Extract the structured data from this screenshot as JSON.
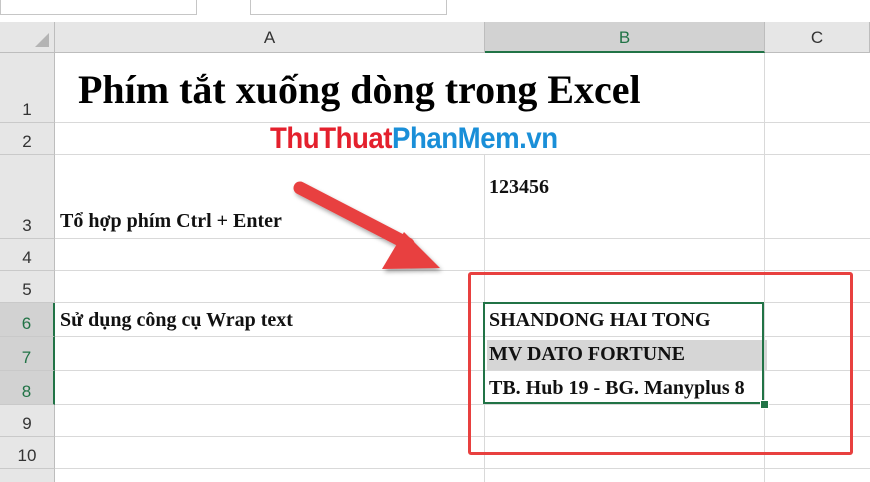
{
  "columns": [
    "A",
    "B",
    "C"
  ],
  "rows": [
    "1",
    "2",
    "3",
    "4",
    "5",
    "6",
    "7",
    "8",
    "9",
    "10"
  ],
  "cells": {
    "A1": "Phím tắt xuống dòng trong Excel",
    "A2_part1": "ThuThuat",
    "A2_part2": "PhanMem.vn",
    "B3": "123456",
    "A3": "Tổ hợp phím Ctrl + Enter",
    "A6": "Sử dụng công cụ Wrap text",
    "B6": "SHANDONG HAI TONG",
    "B7": "MV DATO FORTUNE",
    "B8": "TB. Hub 19 - BG. Manyplus 8"
  },
  "colors": {
    "selection": "#217346",
    "annotation": "#e8403f",
    "brand_red": "#e4202d",
    "brand_blue": "#1a8fd8"
  },
  "selected": {
    "column": "B",
    "rows": [
      "6",
      "7",
      "8"
    ]
  }
}
